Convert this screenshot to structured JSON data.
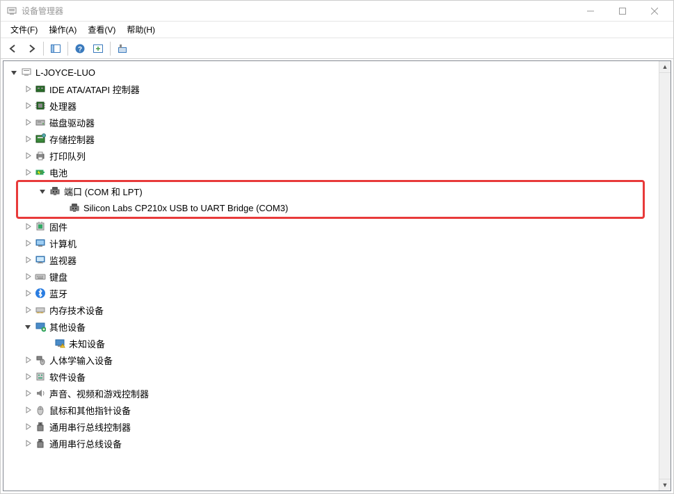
{
  "window": {
    "title": "设备管理器"
  },
  "menu": {
    "file": "文件(F)",
    "action": "操作(A)",
    "view": "查看(V)",
    "help": "帮助(H)"
  },
  "root": {
    "name": "L-JOYCE-LUO"
  },
  "nodes": [
    {
      "label": "IDE ATA/ATAPI 控制器",
      "icon": "ide",
      "expanded": false
    },
    {
      "label": "处理器",
      "icon": "cpu",
      "expanded": false
    },
    {
      "label": "磁盘驱动器",
      "icon": "disk",
      "expanded": false
    },
    {
      "label": "存储控制器",
      "icon": "storage",
      "expanded": false
    },
    {
      "label": "打印队列",
      "icon": "printer",
      "expanded": false
    },
    {
      "label": "电池",
      "icon": "battery",
      "expanded": false
    },
    {
      "label": "端口 (COM 和 LPT)",
      "icon": "port",
      "expanded": true,
      "highlight": true,
      "children": [
        {
          "label": "Silicon Labs CP210x USB to UART Bridge (COM3)",
          "icon": "port"
        }
      ]
    },
    {
      "label": "固件",
      "icon": "firmware",
      "expanded": false
    },
    {
      "label": "计算机",
      "icon": "computer",
      "expanded": false
    },
    {
      "label": "监视器",
      "icon": "monitor",
      "expanded": false
    },
    {
      "label": "键盘",
      "icon": "keyboard",
      "expanded": false
    },
    {
      "label": "蓝牙",
      "icon": "bluetooth",
      "expanded": false
    },
    {
      "label": "内存技术设备",
      "icon": "memory",
      "expanded": false
    },
    {
      "label": "其他设备",
      "icon": "other",
      "expanded": true,
      "children": [
        {
          "label": "未知设备",
          "icon": "unknown"
        }
      ]
    },
    {
      "label": "人体学输入设备",
      "icon": "hid",
      "expanded": false
    },
    {
      "label": "软件设备",
      "icon": "software",
      "expanded": false
    },
    {
      "label": "声音、视频和游戏控制器",
      "icon": "audio",
      "expanded": false
    },
    {
      "label": "鼠标和其他指针设备",
      "icon": "mouse",
      "expanded": false
    },
    {
      "label": "通用串行总线控制器",
      "icon": "usb",
      "expanded": false
    },
    {
      "label": "通用串行总线设备",
      "icon": "usb",
      "expanded": false
    }
  ]
}
